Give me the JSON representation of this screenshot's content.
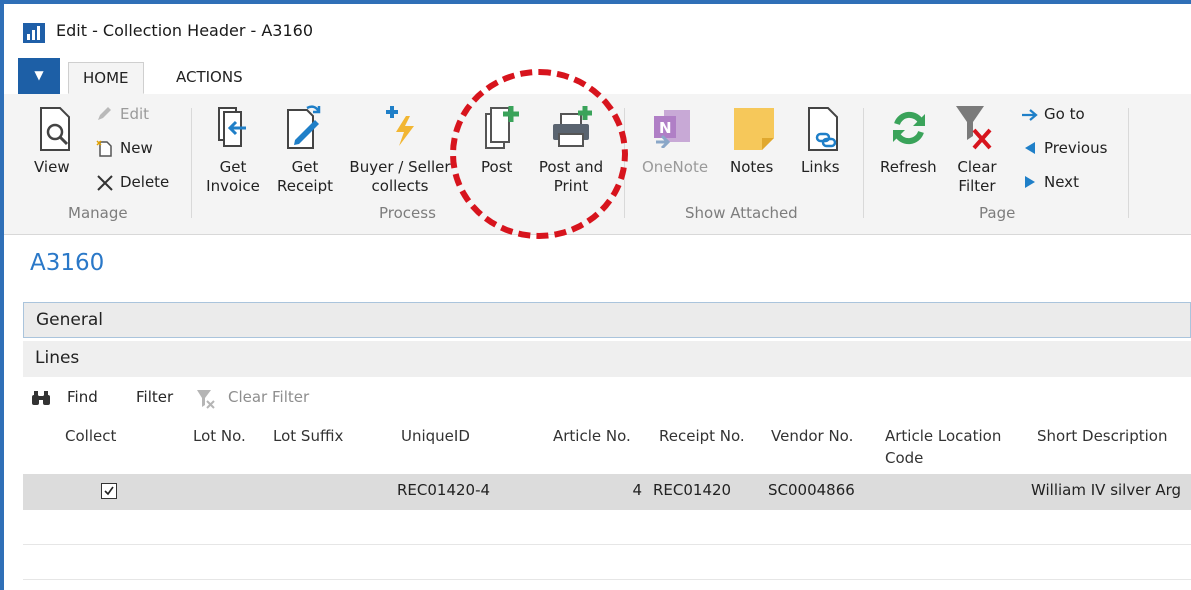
{
  "window": {
    "title": "Edit - Collection Header - A3160"
  },
  "ribbon": {
    "tabs": [
      {
        "label": "HOME"
      },
      {
        "label": "ACTIONS"
      }
    ],
    "groups": {
      "manage": {
        "label": "Manage",
        "view": "View",
        "edit": "Edit",
        "new": "New",
        "delete": "Delete"
      },
      "process": {
        "label": "Process",
        "get_invoice": [
          "Get",
          "Invoice"
        ],
        "get_receipt": [
          "Get",
          "Receipt"
        ],
        "buyer_seller": [
          "Buyer / Seller",
          "collects"
        ],
        "post": "Post",
        "post_and_print": [
          "Post and",
          "Print"
        ]
      },
      "show_attached": {
        "label": "Show Attached",
        "onenote": "OneNote",
        "notes": "Notes",
        "links": "Links"
      },
      "page": {
        "label": "Page",
        "refresh": "Refresh",
        "clear_filter": [
          "Clear",
          "Filter"
        ],
        "go_to": "Go to",
        "previous": "Previous",
        "next": "Next"
      }
    }
  },
  "content": {
    "title": "A3160",
    "sections": {
      "general": "General",
      "lines": "Lines"
    },
    "lines_toolbar": {
      "find": "Find",
      "filter": "Filter",
      "clear_filter": "Clear Filter"
    },
    "table": {
      "columns": [
        "Collect",
        "Lot No.",
        "Lot Suffix",
        "UniqueID",
        "Article No.",
        "Receipt No.",
        "Vendor No.",
        [
          "Article Location",
          "Code"
        ],
        "Short Description"
      ],
      "rows": [
        {
          "collect": true,
          "lot_no": "",
          "lot_suffix": "",
          "unique_id": "REC01420-4",
          "article_no": "4",
          "receipt_no": "REC01420",
          "vendor_no": "SC0004866",
          "article_location_code": "",
          "short_description": "William IV silver Arg"
        }
      ]
    }
  },
  "colors": {
    "accent_blue": "#2a78c8",
    "highlight_red": "#d7141d",
    "ribbon_bg": "#f4f4f4"
  }
}
